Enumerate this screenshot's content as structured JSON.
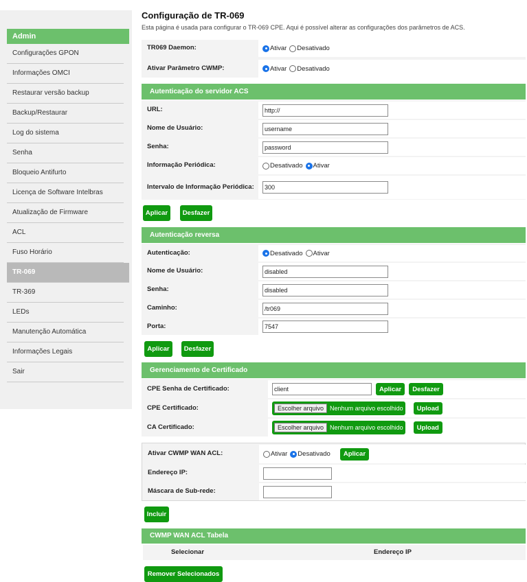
{
  "sidebar": {
    "title": "Admin",
    "items": [
      {
        "label": "Configurações GPON"
      },
      {
        "label": "Informações OMCI"
      },
      {
        "label": "Restaurar versão backup"
      },
      {
        "label": "Backup/Restaurar"
      },
      {
        "label": "Log do sistema"
      },
      {
        "label": "Senha"
      },
      {
        "label": "Bloqueio Antifurto"
      },
      {
        "label": "Licença de Software Intelbras"
      },
      {
        "label": "Atualização de Firmware"
      },
      {
        "label": "ACL"
      },
      {
        "label": "Fuso Horário"
      },
      {
        "label": "TR-069",
        "active": true
      },
      {
        "label": "TR-369"
      },
      {
        "label": "LEDs"
      },
      {
        "label": "Manutenção Automática"
      },
      {
        "label": "Informações Legais"
      },
      {
        "label": "Sair"
      }
    ]
  },
  "page": {
    "title": "Configuração de TR-069",
    "description": "Esta página é usada para configurar o TR-069 CPE. Aqui é possível alterar as configurações dos parâmetros de ACS."
  },
  "daemon": {
    "label": "TR069 Daemon:",
    "options": [
      "Ativar",
      "Desativado"
    ],
    "selected": "Ativar"
  },
  "cwmp_param": {
    "label": "Ativar Parâmetro CWMP:",
    "options": [
      "Ativar",
      "Desativado"
    ],
    "selected": "Ativar"
  },
  "acs": {
    "title": "Autenticação do servidor ACS",
    "url_label": "URL:",
    "url_value": "http://",
    "user_label": "Nome de Usuário:",
    "user_value": "username",
    "pass_label": "Senha:",
    "pass_value": "password",
    "periodic_label": "Informação Periódica:",
    "periodic_options": [
      "Desativado",
      "Ativar"
    ],
    "periodic_selected": "Ativar",
    "interval_label": "Intervalo de Informação Periódica:",
    "interval_value": "300",
    "apply": "Aplicar",
    "undo": "Desfazer"
  },
  "reverse": {
    "title": "Autenticação reversa",
    "auth_label": "Autenticação:",
    "auth_options": [
      "Desativado",
      "Ativar"
    ],
    "auth_selected": "Desativado",
    "user_label": "Nome de Usuário:",
    "user_value": "disabled",
    "pass_label": "Senha:",
    "pass_value": "disabled",
    "path_label": "Caminho:",
    "path_value": "/tr069",
    "port_label": "Porta:",
    "port_value": "7547",
    "apply": "Aplicar",
    "undo": "Desfazer"
  },
  "cert": {
    "title": "Gerenciamento de Certificado",
    "cpe_pass_label": "CPE Senha de Certificado:",
    "cpe_pass_value": "client",
    "apply": "Aplicar",
    "undo": "Desfazer",
    "cpe_cert_label": "CPE Certificado:",
    "ca_cert_label": "CA Certificado:",
    "choose_file": "Escolher arquivo",
    "no_file": "Nenhum arquivo escolhido",
    "upload": "Upload"
  },
  "acl": {
    "enable_label": "Ativar CWMP WAN ACL:",
    "options": [
      "Ativar",
      "Desativado"
    ],
    "selected": "Desativado",
    "apply": "Aplicar",
    "ip_label": "Endereço IP:",
    "ip_value": "",
    "mask_label": "Máscara de Sub-rede:",
    "mask_value": "",
    "add": "Incluir",
    "table_title": "CWMP WAN ACL Tabela",
    "columns": [
      "Selecionar",
      "Endereço IP"
    ],
    "remove": "Remover Selecionados"
  }
}
